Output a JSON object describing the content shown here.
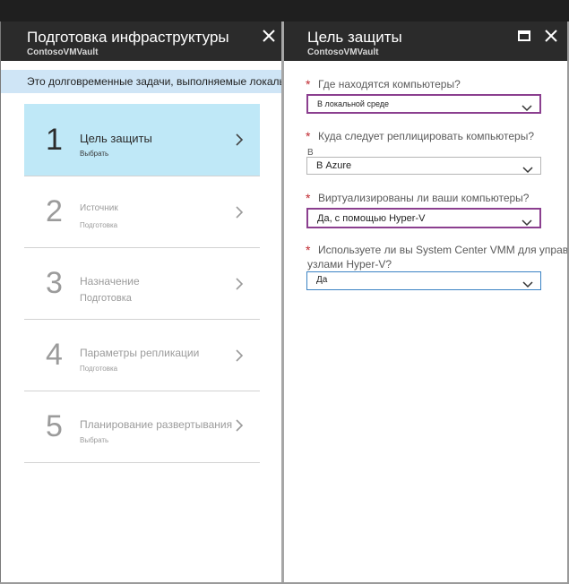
{
  "left_blade": {
    "title": "Подготовка инфраструктуры",
    "subtitle": "ContosoVMVault",
    "info_text": "Это долговременные задачи, выполняемые локально",
    "steps": [
      {
        "number": "1",
        "title": "Цель защиты",
        "subtitle": "Выбрать",
        "active": true
      },
      {
        "number": "2",
        "title": "Источник",
        "subtitle": "Подготовка",
        "active": false
      },
      {
        "number": "3",
        "title": "Назначение",
        "subtitle": "Подготовка",
        "active": false
      },
      {
        "number": "4",
        "title": "Параметры репликации",
        "subtitle": "Подготовка",
        "active": false
      },
      {
        "number": "5",
        "title": "Планирование развертывания",
        "subtitle": "Выбрать",
        "active": false
      }
    ],
    "close_icon": "close-icon"
  },
  "right_blade": {
    "title": "Цель защиты",
    "subtitle": "ContosoVMVault",
    "questions": [
      {
        "required_mark": "*",
        "label": "Где находятся компьютеры?",
        "value": "В локальной среде"
      },
      {
        "required_mark": "*",
        "label": "Куда следует реплицировать компьютеры?",
        "note": "В",
        "value": "В Azure"
      },
      {
        "required_mark": "*",
        "label": "Виртуализированы ли ваши компьютеры?",
        "value": "Да, с помощью Hyper-V"
      },
      {
        "required_mark": "*",
        "label": "Используете ли вы System Center VMM для управ",
        "label_line2": "узлами Hyper-V?",
        "value": "Да"
      }
    ],
    "icons": [
      "maximize-icon",
      "close-icon"
    ]
  },
  "colors": {
    "header_bg": "#2b2b2b",
    "info_bar_bg": "#cfe5f6",
    "active_step_bg": "#bfe8f7",
    "required": "#c0282f",
    "focus_border": "#8b3f8f",
    "blue_border": "#3b83c4"
  }
}
